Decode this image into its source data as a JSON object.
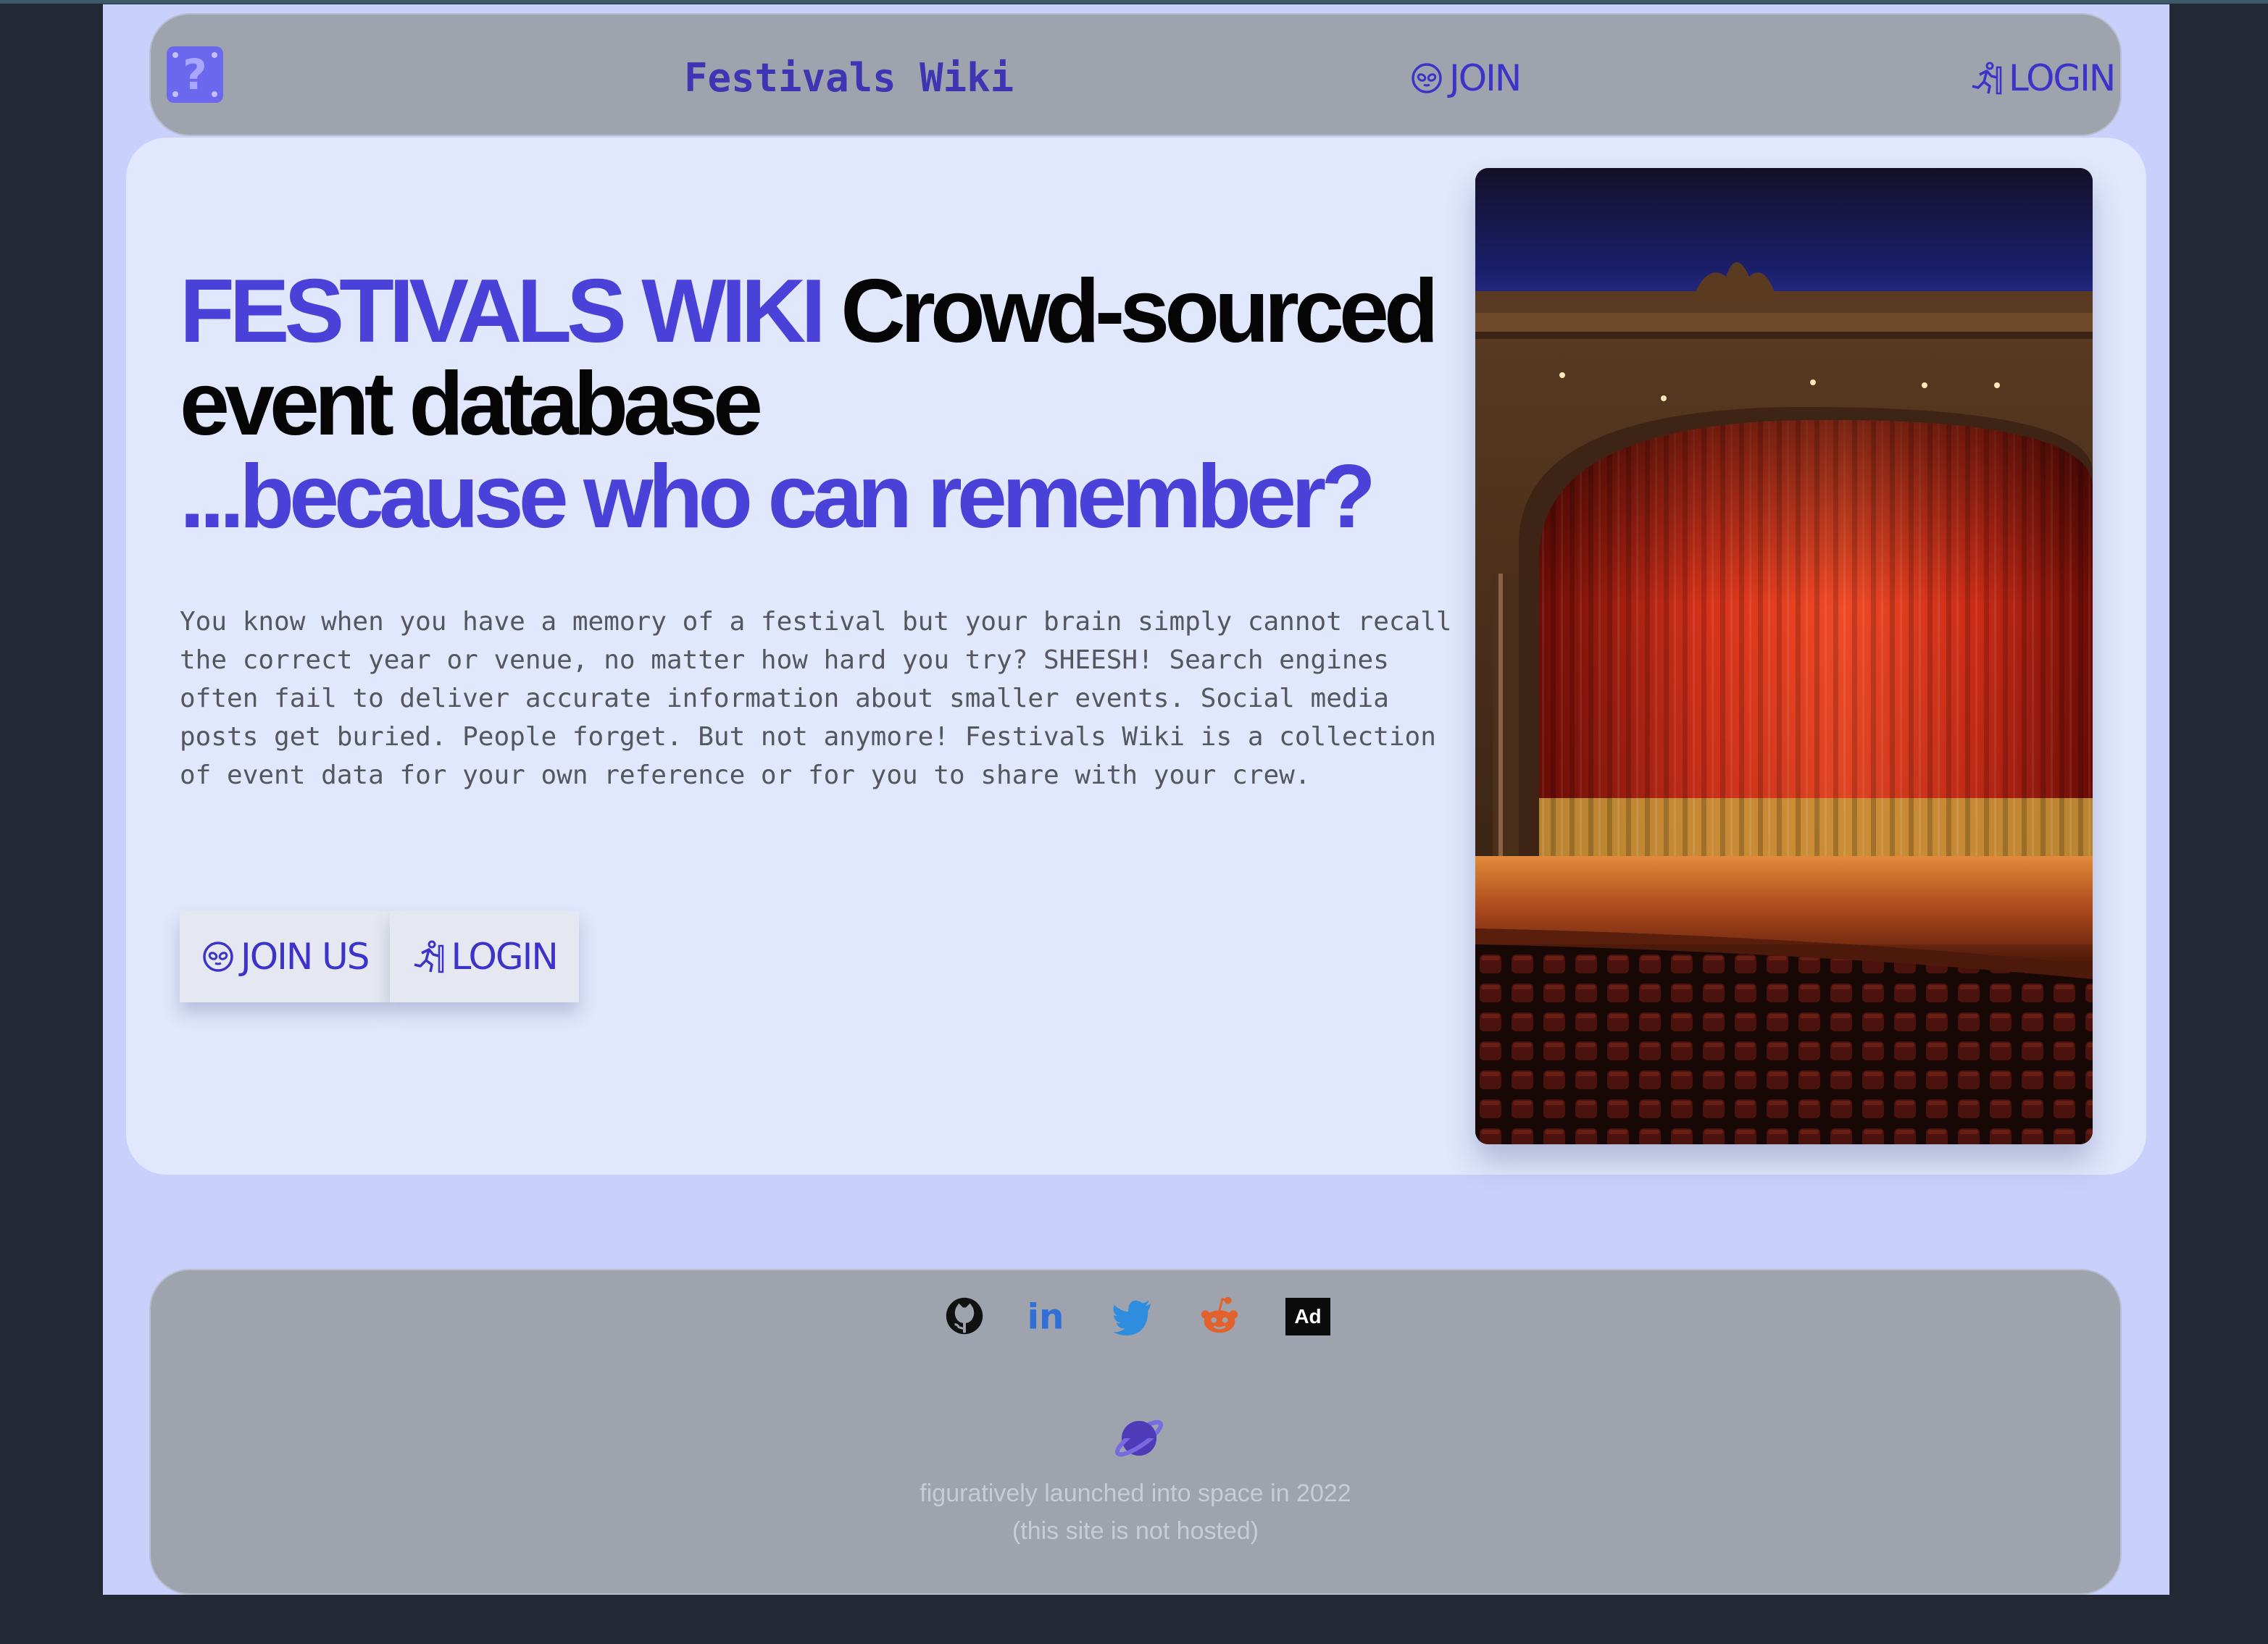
{
  "nav": {
    "title": "Festivals Wiki",
    "join_label": "JOIN",
    "login_label": "LOGIN"
  },
  "hero": {
    "brand": "FESTIVALS WIKI",
    "headline_rest": "Crowd-sourced event database",
    "tagline": "...because who can remember?",
    "description": "You know when you have a memory of a festival but your brain simply cannot recall the correct year or venue, no matter how hard you try? SHEESH! Search engines often fail to deliver accurate information about smaller events. Social media posts get buried. People forget. But not anymore! Festivals Wiki is a collection of event data for your own reference or for you to share with your crew.",
    "join_button": "JOIN US",
    "login_button": "LOGIN"
  },
  "footer": {
    "socials": [
      "github-icon",
      "linkedin-icon",
      "twitter-icon",
      "reddit-icon",
      "ad-icon"
    ],
    "ad_label": "Ad",
    "line1": "figuratively launched into space in 2022",
    "line2": "(this site is not hosted)"
  },
  "colors": {
    "accent": "#4a41d9",
    "nav_bg": "#9ea3ad",
    "hero_bg": "#e1e7fc",
    "page_bg": "#c8d0fb",
    "outer_bg": "#232a36"
  }
}
